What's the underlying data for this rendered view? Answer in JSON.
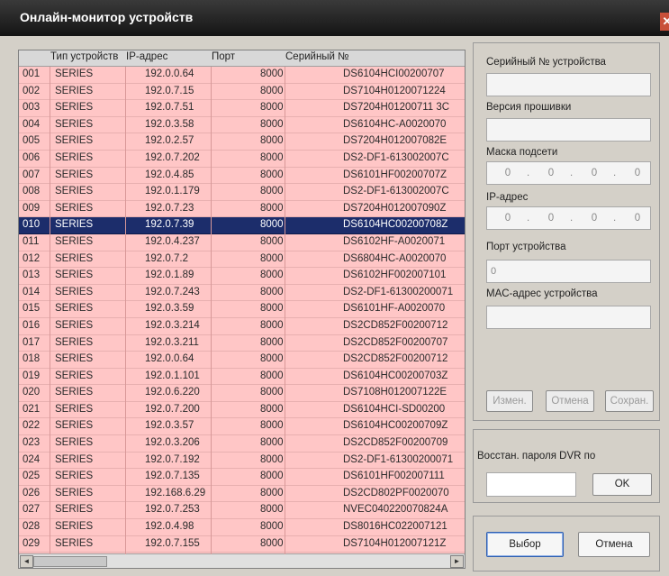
{
  "window": {
    "title": "Онлайн-монитор устройств",
    "close_symbol": "✕"
  },
  "list": {
    "columns": [
      "Тип устройств",
      "IP-адрес",
      "Порт",
      "Серийный №"
    ],
    "rows": [
      {
        "num": "001",
        "type": "SERIES",
        "ip": "192.0.0.64",
        "port": "8000",
        "serial": "DS6104HCI00200707"
      },
      {
        "num": "002",
        "type": "SERIES",
        "ip": "192.0.7.15",
        "port": "8000",
        "serial": "DS7104H0120071224"
      },
      {
        "num": "003",
        "type": "SERIES",
        "ip": "192.0.7.51",
        "port": "8000",
        "serial": "DS7204H01200711 3C"
      },
      {
        "num": "004",
        "type": "SERIES",
        "ip": "192.0.3.58",
        "port": "8000",
        "serial": "DS6104HC-A0020070"
      },
      {
        "num": "005",
        "type": "SERIES",
        "ip": "192.0.2.57",
        "port": "8000",
        "serial": "DS7204H012007082E"
      },
      {
        "num": "006",
        "type": "SERIES",
        "ip": "192.0.7.202",
        "port": "8000",
        "serial": "DS2-DF1-613002007C"
      },
      {
        "num": "007",
        "type": "SERIES",
        "ip": "192.0.4.85",
        "port": "8000",
        "serial": "DS6101HF00200707Z"
      },
      {
        "num": "008",
        "type": "SERIES",
        "ip": "192.0.1.179",
        "port": "8000",
        "serial": "DS2-DF1-613002007C"
      },
      {
        "num": "009",
        "type": "SERIES",
        "ip": "192.0.7.23",
        "port": "8000",
        "serial": "DS7204H012007090Z"
      },
      {
        "num": "010",
        "type": "SERIES",
        "ip": "192.0.7.39",
        "port": "8000",
        "serial": "DS6104HC00200708Z"
      },
      {
        "num": "011",
        "type": "SERIES",
        "ip": "192.0.4.237",
        "port": "8000",
        "serial": "DS6102HF-A0020071"
      },
      {
        "num": "012",
        "type": "SERIES",
        "ip": "192.0.7.2",
        "port": "8000",
        "serial": "DS6804HC-A0020070"
      },
      {
        "num": "013",
        "type": "SERIES",
        "ip": "192.0.1.89",
        "port": "8000",
        "serial": "DS6102HF002007101"
      },
      {
        "num": "014",
        "type": "SERIES",
        "ip": "192.0.7.243",
        "port": "8000",
        "serial": "DS2-DF1-61300200071"
      },
      {
        "num": "015",
        "type": "SERIES",
        "ip": "192.0.3.59",
        "port": "8000",
        "serial": "DS6101HF-A0020070"
      },
      {
        "num": "016",
        "type": "SERIES",
        "ip": "192.0.3.214",
        "port": "8000",
        "serial": "DS2CD852F00200712"
      },
      {
        "num": "017",
        "type": "SERIES",
        "ip": "192.0.3.211",
        "port": "8000",
        "serial": "DS2CD852F00200707"
      },
      {
        "num": "018",
        "type": "SERIES",
        "ip": "192.0.0.64",
        "port": "8000",
        "serial": "DS2CD852F00200712"
      },
      {
        "num": "019",
        "type": "SERIES",
        "ip": "192.0.1.101",
        "port": "8000",
        "serial": "DS6104HC00200703Z"
      },
      {
        "num": "020",
        "type": "SERIES",
        "ip": "192.0.6.220",
        "port": "8000",
        "serial": "DS7108H012007122E"
      },
      {
        "num": "021",
        "type": "SERIES",
        "ip": "192.0.7.200",
        "port": "8000",
        "serial": "DS6104HCI-SD00200"
      },
      {
        "num": "022",
        "type": "SERIES",
        "ip": "192.0.3.57",
        "port": "8000",
        "serial": "DS6104HC00200709Z"
      },
      {
        "num": "023",
        "type": "SERIES",
        "ip": "192.0.3.206",
        "port": "8000",
        "serial": "DS2CD852F00200709"
      },
      {
        "num": "024",
        "type": "SERIES",
        "ip": "192.0.7.192",
        "port": "8000",
        "serial": "DS2-DF1-61300200071"
      },
      {
        "num": "025",
        "type": "SERIES",
        "ip": "192.0.7.135",
        "port": "8000",
        "serial": "DS6101HF002007111"
      },
      {
        "num": "026",
        "type": "SERIES",
        "ip": "192.168.6.29",
        "port": "8000",
        "serial": "DS2CD802PF0020070"
      },
      {
        "num": "027",
        "type": "SERIES",
        "ip": "192.0.7.253",
        "port": "8000",
        "serial": "NVEC040220070824A"
      },
      {
        "num": "028",
        "type": "SERIES",
        "ip": "192.0.4.98",
        "port": "8000",
        "serial": "DS8016HC022007121"
      },
      {
        "num": "029",
        "type": "SERIES",
        "ip": "192.0.7.155",
        "port": "8000",
        "serial": "DS7104H012007121Z"
      }
    ],
    "selected_row_index": 9,
    "scroll_left_arrow": "◄",
    "scroll_right_arrow": "►"
  },
  "details": {
    "serial_label": "Серийный № устройства",
    "serial_value": "",
    "firmware_label": "Версия прошивки",
    "firmware_value": "",
    "mask_label": "Маска подсети",
    "mask_octets": [
      "0",
      "0",
      "0",
      "0"
    ],
    "ip_label": "IP-адрес",
    "ip_octets": [
      "0",
      "0",
      "0",
      "0"
    ],
    "port_label": "Порт устройства",
    "port_value": "0",
    "mac_label": "MAC-адрес устройства",
    "mac_value": "",
    "modify_button": "Измен.",
    "cancel_button": "Отмена",
    "save_button": "Сохран."
  },
  "restore": {
    "label": "Восстан. пароля DVR по",
    "input_value": "",
    "ok_button": "OK"
  },
  "footer": {
    "select_button": "Выбор",
    "cancel_button": "Отмена"
  },
  "colors": {
    "row_background": "#ffc6c6",
    "selected_row_background": "#1c2d6b",
    "titlebar": "#1e1e1e",
    "window_background": "#d4d0c8"
  }
}
